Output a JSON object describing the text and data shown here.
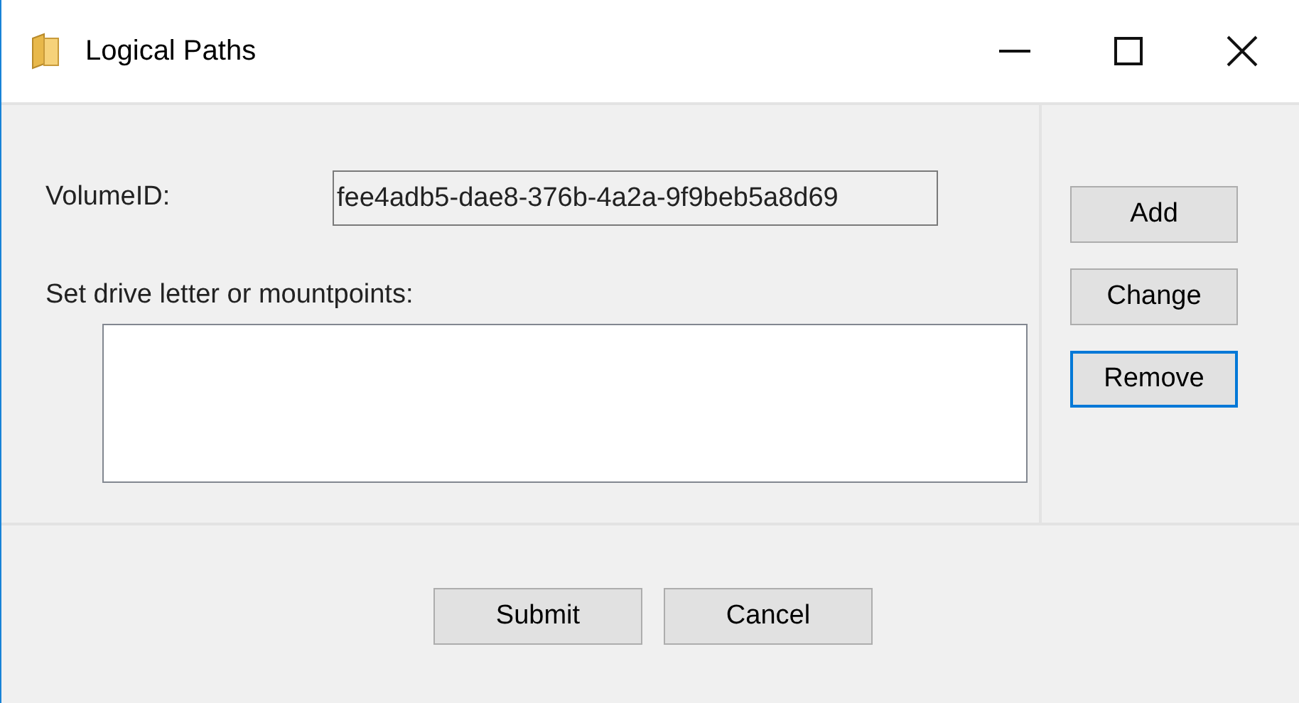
{
  "window": {
    "title": "Logical Paths"
  },
  "volume_id": {
    "label": "VolumeID:",
    "value": "fee4adb5-dae8-376b-4a2a-9f9beb5a8d69"
  },
  "mountpoints": {
    "label": "Set drive letter or mountpoints:"
  },
  "side_buttons": [
    {
      "label": "Add",
      "focused": false
    },
    {
      "label": "Change",
      "focused": false
    },
    {
      "label": "Remove",
      "focused": true
    }
  ],
  "footer_buttons": [
    {
      "label": "Submit",
      "focused": false
    },
    {
      "label": "Cancel",
      "focused": false
    }
  ]
}
